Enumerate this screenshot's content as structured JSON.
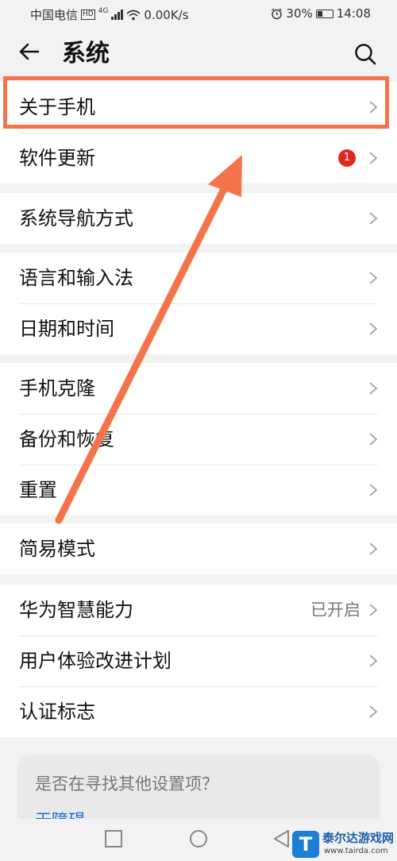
{
  "status_bar": {
    "carrier": "中国电信",
    "network_badge": "HD",
    "signal_gen": "4G",
    "speed": "0.00K/s",
    "alarm_icon": "alarm-icon",
    "battery_percent": "30%",
    "time": "14:08"
  },
  "header": {
    "back_icon": "back-arrow-icon",
    "title": "系统",
    "search_icon": "search-icon"
  },
  "groups": [
    {
      "items": [
        {
          "label": "关于手机"
        },
        {
          "label": "软件更新",
          "badge": "1"
        }
      ]
    },
    {
      "items": [
        {
          "label": "系统导航方式"
        }
      ]
    },
    {
      "items": [
        {
          "label": "语言和输入法"
        },
        {
          "label": "日期和时间"
        }
      ]
    },
    {
      "items": [
        {
          "label": "手机克隆"
        },
        {
          "label": "备份和恢复"
        },
        {
          "label": "重置"
        }
      ]
    },
    {
      "items": [
        {
          "label": "简易模式"
        }
      ]
    },
    {
      "items": [
        {
          "label": "华为智慧能力",
          "value": "已开启"
        },
        {
          "label": "用户体验改进计划"
        },
        {
          "label": "认证标志"
        }
      ]
    }
  ],
  "suggestion": {
    "question": "是否在寻找其他设置项？",
    "link": "无障碍"
  },
  "nav_bar": {
    "icons": [
      "recent-apps-icon",
      "home-icon",
      "back-icon"
    ]
  },
  "watermark": {
    "logo_letter": "T",
    "title": "泰尔达游戏网",
    "url": "www.tairda.com"
  },
  "annotation": {
    "highlight_color": "#f4734a",
    "arrow_color": "#f4734a"
  },
  "colors": {
    "background": "#f2f2f2",
    "card": "#ffffff",
    "badge": "#e0271c",
    "link": "#1a6fd0"
  }
}
